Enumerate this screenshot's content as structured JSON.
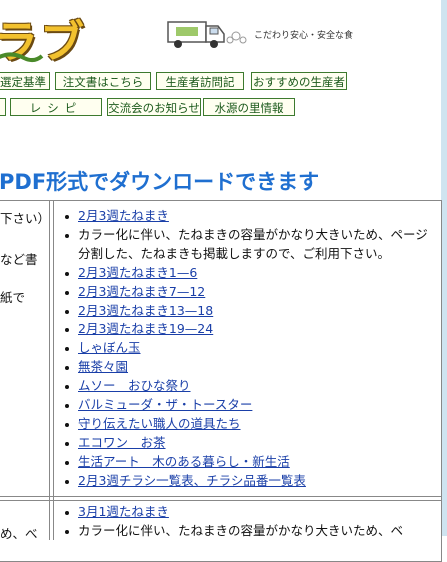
{
  "header": {
    "logo_text": "ラブ",
    "tagline": "こだわり安心・安全な食"
  },
  "nav_row1": [
    "選定基準",
    "注文書はこちら",
    "生産者訪問記",
    "おすすめの生産者"
  ],
  "nav_row2": [
    "レシピ",
    "交流会のお知らせ",
    "水源の里情報"
  ],
  "heading": "PDF形式でダウンロードできます",
  "left_fragments": [
    "下さい）",
    "など書",
    "紙で"
  ],
  "left_fragment_bottom": "め、べ",
  "block1": {
    "items": [
      {
        "text": "2月3週たねまき",
        "link": true
      },
      {
        "text": "カラー化に伴い、たねまきの容量がかなり大きいため、ページ分割した、たねまきも掲載しますので、ご利用下さい。",
        "link": false
      },
      {
        "text": "2月3週たねまき1—6",
        "link": true
      },
      {
        "text": "2月3週たねまき7—12",
        "link": true
      },
      {
        "text": "2月3週たねまき13—18",
        "link": true
      },
      {
        "text": "2月3週たねまき19—24",
        "link": true
      },
      {
        "text": "しゃぼん玉",
        "link": true
      },
      {
        "text": "無茶々園",
        "link": true
      },
      {
        "text": "ムソー　おひな祭り",
        "link": true
      },
      {
        "text": "バルミューダ・ザ・トースター",
        "link": true
      },
      {
        "text": "守り伝えたい職人の道具たち",
        "link": true
      },
      {
        "text": "エコワン　お茶",
        "link": true
      },
      {
        "text": "生活アート　木のある暮らし・新生活",
        "link": true
      },
      {
        "text": "2月3週チラシ一覧表、チラシ品番一覧表",
        "link": true
      }
    ]
  },
  "block2": {
    "items": [
      {
        "text": "3月1週たねまき",
        "link": true
      },
      {
        "text": "カラー化に伴い、たねまきの容量がかなり大きいため、ベ",
        "link": false
      }
    ]
  },
  "colors": {
    "heading": "#1f6fd0",
    "link": "#1a3fa8",
    "nav_border": "#3d7a2e",
    "logo": "#f2c12e"
  }
}
